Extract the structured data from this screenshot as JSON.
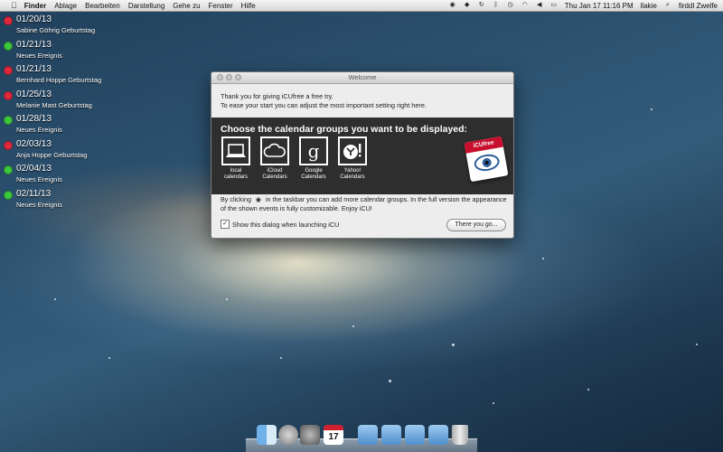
{
  "menubar": {
    "apple_icon": "apple-icon",
    "items": [
      "Finder",
      "Ablage",
      "Bearbeiten",
      "Darstellung",
      "Gehe zu",
      "Fenster",
      "Hilfe"
    ],
    "clock": "Thu Jan 17  11:16 PM",
    "user": "llakie",
    "search_icon": "magnifier-icon",
    "right_label": "firddl Zwelfe"
  },
  "events": [
    {
      "date": "01/20/13",
      "name": "Sabine Göhrig Geburtstag",
      "color": "#e0283c"
    },
    {
      "date": "01/21/13",
      "name": "Neues Ereignis",
      "color": "#3cc83c"
    },
    {
      "date": "01/21/13",
      "name": "Bernhard Hoppe Geburtstag",
      "color": "#e0283c"
    },
    {
      "date": "01/25/13",
      "name": "Melanie Mast Geburtstag",
      "color": "#e0283c"
    },
    {
      "date": "01/28/13",
      "name": "Neues Ereignis",
      "color": "#3cc83c"
    },
    {
      "date": "02/03/13",
      "name": "Anja Hoppe Geburtstag",
      "color": "#e0283c"
    },
    {
      "date": "02/04/13",
      "name": "Neues Ereignis",
      "color": "#3cc83c"
    },
    {
      "date": "02/11/13",
      "name": "Neues Ereignis",
      "color": "#3cc83c"
    }
  ],
  "dialog": {
    "title": "Welcome",
    "intro_line1": "Thank you for giving iCUfree a free try.",
    "intro_line2": "To ease your start you can adjust the most important setting right here.",
    "heading": "Choose the calendar groups you want to be displayed:",
    "badge_label": "iCUfree",
    "calendars": [
      {
        "line1": "local",
        "line2": "calendars",
        "icon": "laptop-icon"
      },
      {
        "line1": "iCloud",
        "line2": "Calendars",
        "icon": "cloud-icon"
      },
      {
        "line1": "Google",
        "line2": "Calendars",
        "icon": "google-g-icon"
      },
      {
        "line1": "Yahoo!",
        "line2": "Calendars",
        "icon": "yahoo-icon"
      }
    ],
    "hint_before_icon": "By clicking",
    "hint_after_icon": "in the taskbar you can add more calendar groups. In the full version the appearance of the shown events is fully customizable. Enjoy iCU!",
    "checkbox_label": "Show this dialog when launching iCU",
    "checkbox_checked": true,
    "button_label": "There you go..."
  },
  "dock": {
    "calendar_day": "17",
    "items": [
      "finder-icon",
      "launchpad-icon",
      "system-preferences-icon",
      "calendar-icon",
      "applications-folder-icon",
      "documents-folder-icon",
      "downloads-folder-icon",
      "trash-icon"
    ]
  }
}
